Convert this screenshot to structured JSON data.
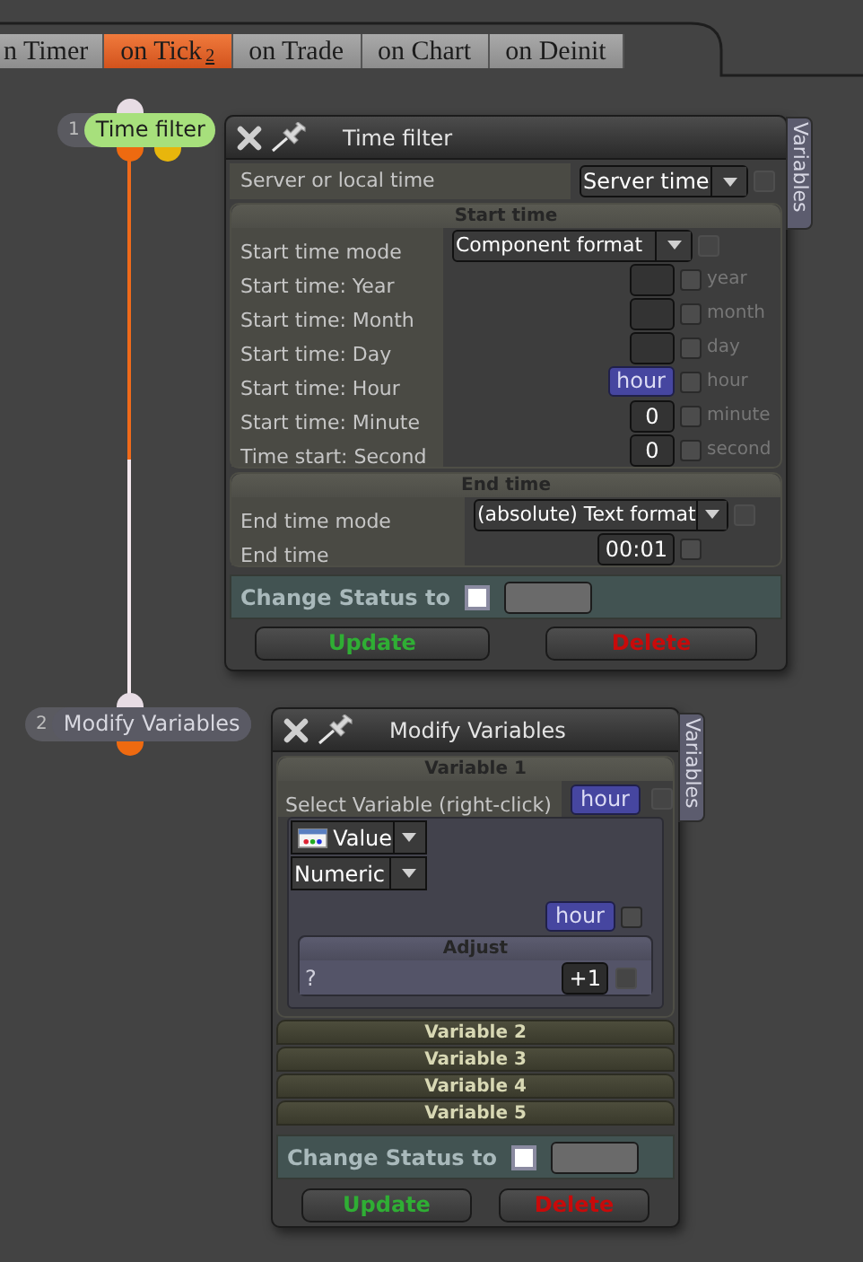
{
  "tabs": [
    {
      "label": "n Timer",
      "selected": false
    },
    {
      "label": "on Tick",
      "badge": "2",
      "selected": true
    },
    {
      "label": "on Trade",
      "selected": false
    },
    {
      "label": "on Chart",
      "selected": false
    },
    {
      "label": "on Deinit",
      "selected": false
    }
  ],
  "nodes": [
    {
      "number": "1",
      "label": "Time filter",
      "selected": true
    },
    {
      "number": "2",
      "label": "Modify Variables",
      "selected": false
    }
  ],
  "time_filter_window": {
    "title": "Time filter",
    "side_tab": "Variables",
    "server_row": {
      "label": "Server or local time",
      "value": "Server time",
      "checked": false
    },
    "sections": [
      {
        "title": "Start time",
        "rows": [
          {
            "kind": "dropdown",
            "label": "Start time mode",
            "value": "Component format",
            "checked": false
          },
          {
            "kind": "field",
            "label": "Start time: Year",
            "unit": "year",
            "checked": false
          },
          {
            "kind": "field",
            "label": "Start time: Month",
            "unit": "month",
            "checked": false
          },
          {
            "kind": "field",
            "label": "Start time: Day",
            "unit": "day",
            "checked": false
          },
          {
            "kind": "variable",
            "label": "Start time: Hour",
            "value": "hour",
            "unit": "hour",
            "checked": false
          },
          {
            "kind": "field",
            "label": "Start time: Minute",
            "value": "0",
            "unit": "minute",
            "checked": false
          },
          {
            "kind": "field",
            "label": "Time start: Second",
            "value": "0",
            "unit": "second",
            "checked": false
          }
        ]
      },
      {
        "title": "End time",
        "rows": [
          {
            "kind": "dropdown",
            "label": "End time mode",
            "value": "(absolute) Text format",
            "checked": false
          },
          {
            "kind": "field",
            "label": "End time",
            "value": "00:01",
            "checked": false
          }
        ]
      }
    ],
    "change_status": {
      "label": "Change Status to",
      "checked": false
    },
    "buttons": [
      {
        "label": "Update",
        "kind": "update"
      },
      {
        "label": "Delete",
        "kind": "delete"
      }
    ]
  },
  "modify_variables_window": {
    "title": "Modify Variables",
    "side_tab": "Variables",
    "variables": [
      {
        "title": "Variable 1",
        "expanded": true,
        "select_label": "Select Variable (right-click)",
        "selected_variable": "hour",
        "value_mode": "Value",
        "type": "Numeric",
        "target": "hour",
        "select_checked": false,
        "target_checked": false,
        "adjust": {
          "title": "Adjust",
          "label": "?",
          "value": "+1",
          "checked": false
        }
      },
      {
        "title": "Variable 2",
        "expanded": false
      },
      {
        "title": "Variable 3",
        "expanded": false
      },
      {
        "title": "Variable 4",
        "expanded": false
      },
      {
        "title": "Variable 5",
        "expanded": false
      }
    ],
    "change_status": {
      "label": "Change Status to",
      "checked": false
    },
    "buttons": [
      {
        "label": "Update",
        "kind": "update"
      },
      {
        "label": "Delete",
        "kind": "delete"
      }
    ]
  }
}
